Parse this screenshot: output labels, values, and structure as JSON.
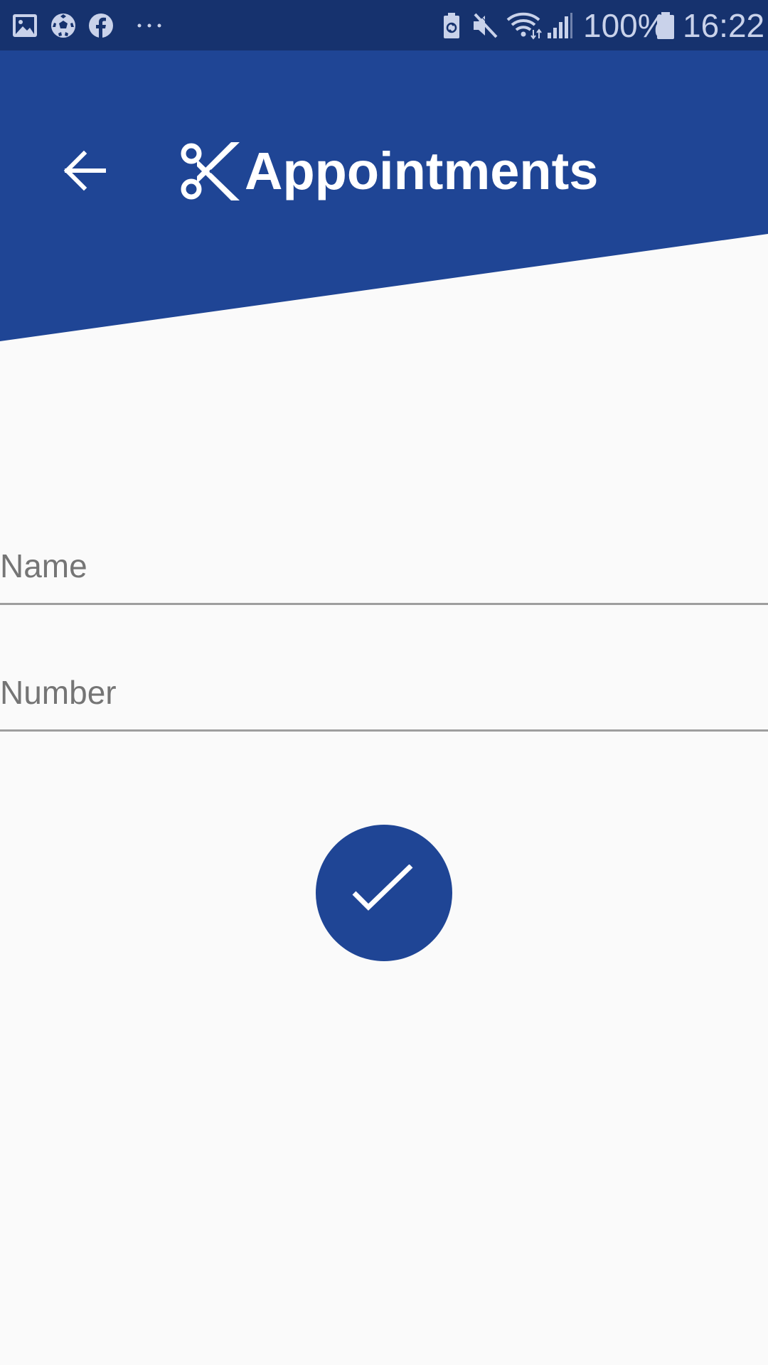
{
  "status_bar": {
    "notification_icons": [
      "gallery-icon",
      "soccer-ball-icon",
      "facebook-icon",
      "more-dots-icon"
    ],
    "system_icons": [
      "battery-saver-icon",
      "mute-icon",
      "wifi-icon",
      "signal-icon",
      "battery-icon"
    ],
    "battery_percent": "100%",
    "time": "16:22"
  },
  "header": {
    "title": "Appointments",
    "back_icon": "arrow-left-icon",
    "logo_icon": "scissors-icon"
  },
  "form": {
    "name_placeholder": "Name",
    "name_value": "",
    "number_placeholder": "Number",
    "number_value": ""
  },
  "submit": {
    "icon": "check-icon"
  },
  "colors": {
    "status_bar": "#16326e",
    "header": "#1f4595",
    "fab": "#1f4595",
    "background": "#fafafa",
    "underline": "#9e9e9e",
    "placeholder": "#757575"
  }
}
